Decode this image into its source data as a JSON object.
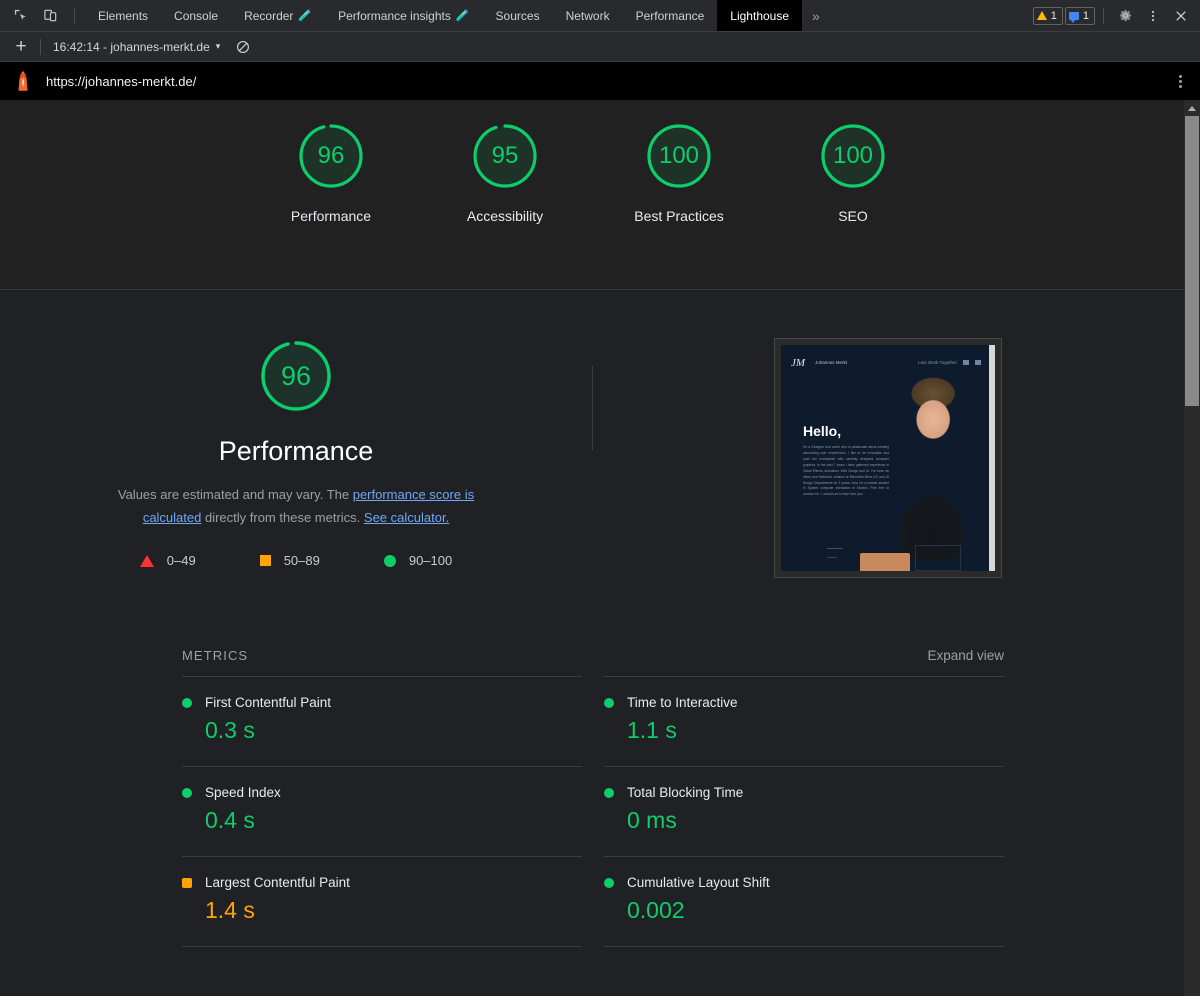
{
  "devtools": {
    "icons": [
      {
        "name": "inspect-element-icon",
        "title": "Inspect element"
      },
      {
        "name": "device-toolbar-icon",
        "title": "Toggle device toolbar"
      }
    ],
    "tabs": [
      {
        "label": "Elements",
        "selected": false,
        "flask": false
      },
      {
        "label": "Console",
        "selected": false,
        "flask": false
      },
      {
        "label": "Recorder",
        "selected": false,
        "flask": true
      },
      {
        "label": "Performance insights",
        "selected": false,
        "flask": true
      },
      {
        "label": "Sources",
        "selected": false,
        "flask": false
      },
      {
        "label": "Network",
        "selected": false,
        "flask": false
      },
      {
        "label": "Performance",
        "selected": false,
        "flask": false
      },
      {
        "label": "Lighthouse",
        "selected": true,
        "flask": false
      }
    ],
    "more_tabs": "»",
    "warning_count": "1",
    "message_count": "1",
    "settings_label": "Settings",
    "kebab_label": "Customize and control DevTools",
    "close_label": "Close DevTools"
  },
  "controls": {
    "new_report_label": "+",
    "report_selector": "16:42:14 - johannes-merkt.de",
    "caret": "▾",
    "clear_label": "Clear all"
  },
  "urlbar": {
    "url": "https://johannes-merkt.de/",
    "logo_name": "lighthouse-logo"
  },
  "category_gauges": [
    {
      "label": "Performance",
      "score": "96",
      "value": 96,
      "color": "#0cce6b"
    },
    {
      "label": "Accessibility",
      "score": "95",
      "value": 95,
      "color": "#0cce6b"
    },
    {
      "label": "Best Practices",
      "score": "100",
      "value": 100,
      "color": "#0cce6b"
    },
    {
      "label": "SEO",
      "score": "100",
      "value": 100,
      "color": "#0cce6b"
    }
  ],
  "performance": {
    "score": "96",
    "score_value": 96,
    "title": "Performance",
    "description_part1": "Values are estimated and may vary. The ",
    "link1": "performance score is calculated",
    "description_part2": " directly from these metrics. ",
    "link2": "See calculator.",
    "legend": [
      {
        "marker": "triangle",
        "range": "0–49",
        "color": "#ff3333"
      },
      {
        "marker": "square",
        "range": "50–89",
        "color": "#ffa400"
      },
      {
        "marker": "circle",
        "range": "90–100",
        "color": "#0cce6b"
      }
    ]
  },
  "thumbnail": {
    "logo": "JM",
    "name": "Johannes Merkt",
    "nav_link": "Lets Work Together",
    "heading": "Hello,",
    "body": "I'm a Designer and coder who is passionate about creating astounding user experiences. I like to be innovative and push the boundaries with carefully designed computer graphics. In the past 7 years I have gathered experience in Visual Effects, Animation, Web Design and UI. I've been an intern and freelance creative at Mercedes-Benz UX and UI Design Departments for 2 years. Now I'm a master student in System computer interaction in Munich. Feel free to contact me - I would love to hear from you."
  },
  "metrics_section": {
    "title": "METRICS",
    "expand_view": "Expand view",
    "items": [
      {
        "name": "First Contentful Paint",
        "value": "0.3 s",
        "status": "pass",
        "marker": "circle",
        "color": "#0cce6b"
      },
      {
        "name": "Time to Interactive",
        "value": "1.1 s",
        "status": "pass",
        "marker": "circle",
        "color": "#0cce6b"
      },
      {
        "name": "Speed Index",
        "value": "0.4 s",
        "status": "pass",
        "marker": "circle",
        "color": "#0cce6b"
      },
      {
        "name": "Total Blocking Time",
        "value": "0 ms",
        "status": "pass",
        "marker": "circle",
        "color": "#0cce6b"
      },
      {
        "name": "Largest Contentful Paint",
        "value": "1.4 s",
        "status": "average",
        "marker": "square",
        "color": "#ffa400"
      },
      {
        "name": "Cumulative Layout Shift",
        "value": "0.002",
        "status": "pass",
        "marker": "circle",
        "color": "#0cce6b"
      }
    ]
  },
  "colors": {
    "pass": "#0cce6b",
    "average": "#ffa400",
    "fail": "#ff3333",
    "link": "#6fa8f5",
    "background": "#202124",
    "panel": "#212121"
  }
}
